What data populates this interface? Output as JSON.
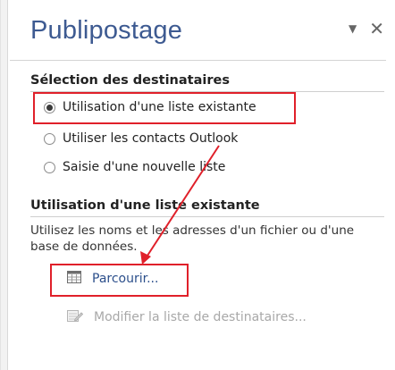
{
  "pane": {
    "title": "Publipostage",
    "menu_icon": "dropdown-arrow-icon",
    "close_label": "✕"
  },
  "recipients_section": {
    "title": "Sélection des destinataires",
    "options": [
      {
        "label": "Utilisation d'une liste existante",
        "selected": true
      },
      {
        "label": "Utiliser les contacts Outlook",
        "selected": false
      },
      {
        "label": "Saisie d'une nouvelle liste",
        "selected": false
      }
    ]
  },
  "existing_list_section": {
    "title": "Utilisation d'une liste existante",
    "description": "Utilisez les noms et les adresses d'un fichier ou d'une base de données.",
    "browse_label": "Parcourir...",
    "modify_label": "Modifier la liste de destinataires..."
  },
  "colors": {
    "title": "#3d5a91",
    "link": "#2c4f8b",
    "disabled": "#a8a8a8",
    "annotation": "#e0202a"
  }
}
